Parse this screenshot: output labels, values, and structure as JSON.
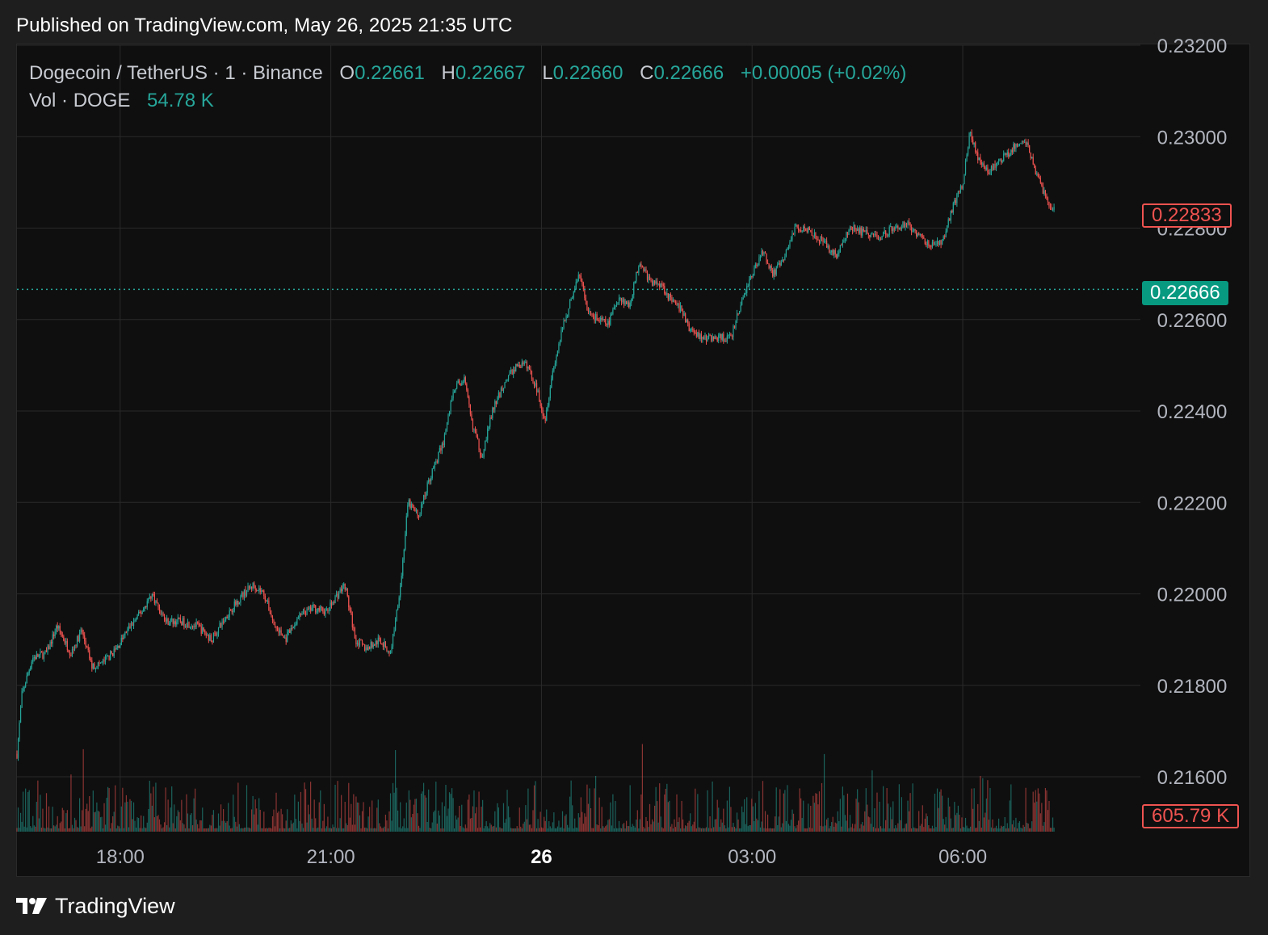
{
  "header": {
    "published": "Published on TradingView.com, May 26, 2025 21:35 UTC"
  },
  "legend": {
    "symbol": "Dogecoin / TetherUS · 1 · Binance",
    "open_label": "O",
    "open": "0.22661",
    "high_label": "H",
    "high": "0.22667",
    "low_label": "L",
    "low": "0.22660",
    "close_label": "C",
    "close": "0.22666",
    "change": "+0.00005 (+0.02%)",
    "volume_label": "Vol · DOGE",
    "volume": "54.78 K"
  },
  "price_tags": {
    "last_red": "0.22833",
    "current_green": "0.22666",
    "volume_red": "605.79 K"
  },
  "footer": {
    "brand": "TradingView"
  },
  "colors": {
    "up": "#26a69a",
    "down": "#ef5350",
    "grid": "#2a2a2a",
    "background": "#0f0f0f"
  },
  "chart_data": {
    "type": "candlestick",
    "interval": "1 minute",
    "y_ticks": [
      "0.23200",
      "0.23000",
      "0.22800",
      "0.22600",
      "0.22400",
      "0.22200",
      "0.22000",
      "0.21800",
      "0.21600"
    ],
    "ylim": [
      0.2148,
      0.232
    ],
    "x_ticks": [
      {
        "label": "18:00",
        "t": 18.0,
        "bold": false
      },
      {
        "label": "21:00",
        "t": 21.0,
        "bold": false
      },
      {
        "label": "26",
        "t": 24.0,
        "bold": true
      },
      {
        "label": "03:00",
        "t": 27.0,
        "bold": false
      },
      {
        "label": "06:00",
        "t": 30.0,
        "bold": false
      }
    ],
    "xlim_hours": [
      16.53,
      32.53
    ],
    "current_price_line": 0.22666,
    "price_path": [
      [
        16.53,
        0.2165
      ],
      [
        16.6,
        0.2178
      ],
      [
        16.75,
        0.2186
      ],
      [
        16.95,
        0.2187
      ],
      [
        17.1,
        0.2193
      ],
      [
        17.3,
        0.2187
      ],
      [
        17.45,
        0.2192
      ],
      [
        17.6,
        0.2184
      ],
      [
        17.75,
        0.2185
      ],
      [
        17.95,
        0.2188
      ],
      [
        18.1,
        0.2192
      ],
      [
        18.3,
        0.2196
      ],
      [
        18.45,
        0.22
      ],
      [
        18.65,
        0.2194
      ],
      [
        18.85,
        0.2194
      ],
      [
        19.1,
        0.2193
      ],
      [
        19.3,
        0.219
      ],
      [
        19.55,
        0.2196
      ],
      [
        19.75,
        0.22
      ],
      [
        19.9,
        0.2202
      ],
      [
        20.05,
        0.22
      ],
      [
        20.2,
        0.2193
      ],
      [
        20.35,
        0.219
      ],
      [
        20.55,
        0.2195
      ],
      [
        20.75,
        0.2197
      ],
      [
        20.95,
        0.2196
      ],
      [
        21.05,
        0.2199
      ],
      [
        21.2,
        0.2202
      ],
      [
        21.35,
        0.219
      ],
      [
        21.5,
        0.2188
      ],
      [
        21.7,
        0.219
      ],
      [
        21.85,
        0.2187
      ],
      [
        22.0,
        0.2203
      ],
      [
        22.1,
        0.222
      ],
      [
        22.25,
        0.2217
      ],
      [
        22.4,
        0.2225
      ],
      [
        22.6,
        0.2233
      ],
      [
        22.75,
        0.2245
      ],
      [
        22.9,
        0.2247
      ],
      [
        23.0,
        0.2238
      ],
      [
        23.15,
        0.223
      ],
      [
        23.3,
        0.224
      ],
      [
        23.5,
        0.2247
      ],
      [
        23.65,
        0.225
      ],
      [
        23.8,
        0.225
      ],
      [
        23.95,
        0.2244
      ],
      [
        24.05,
        0.2238
      ],
      [
        24.15,
        0.2248
      ],
      [
        24.3,
        0.2258
      ],
      [
        24.45,
        0.2266
      ],
      [
        24.55,
        0.227
      ],
      [
        24.65,
        0.2262
      ],
      [
        24.8,
        0.226
      ],
      [
        24.95,
        0.2259
      ],
      [
        25.1,
        0.2265
      ],
      [
        25.25,
        0.2263
      ],
      [
        25.4,
        0.2273
      ],
      [
        25.55,
        0.2268
      ],
      [
        25.7,
        0.2268
      ],
      [
        25.85,
        0.2264
      ],
      [
        26.0,
        0.2262
      ],
      [
        26.1,
        0.2258
      ],
      [
        26.3,
        0.2256
      ],
      [
        26.5,
        0.2256
      ],
      [
        26.7,
        0.2256
      ],
      [
        26.85,
        0.2264
      ],
      [
        27.0,
        0.227
      ],
      [
        27.15,
        0.2275
      ],
      [
        27.3,
        0.227
      ],
      [
        27.45,
        0.2273
      ],
      [
        27.6,
        0.228
      ],
      [
        27.8,
        0.228
      ],
      [
        28.0,
        0.2277
      ],
      [
        28.2,
        0.2274
      ],
      [
        28.4,
        0.228
      ],
      [
        28.6,
        0.2279
      ],
      [
        28.8,
        0.2278
      ],
      [
        29.0,
        0.228
      ],
      [
        29.2,
        0.2281
      ],
      [
        29.4,
        0.2278
      ],
      [
        29.55,
        0.2276
      ],
      [
        29.7,
        0.2277
      ],
      [
        29.85,
        0.2284
      ],
      [
        30.0,
        0.229
      ],
      [
        30.1,
        0.2301
      ],
      [
        30.2,
        0.2296
      ],
      [
        30.35,
        0.2292
      ],
      [
        30.55,
        0.2295
      ],
      [
        30.75,
        0.2298
      ],
      [
        30.9,
        0.2299
      ],
      [
        31.05,
        0.2292
      ],
      [
        31.2,
        0.2286
      ],
      [
        31.3,
        0.2284
      ]
    ]
  }
}
